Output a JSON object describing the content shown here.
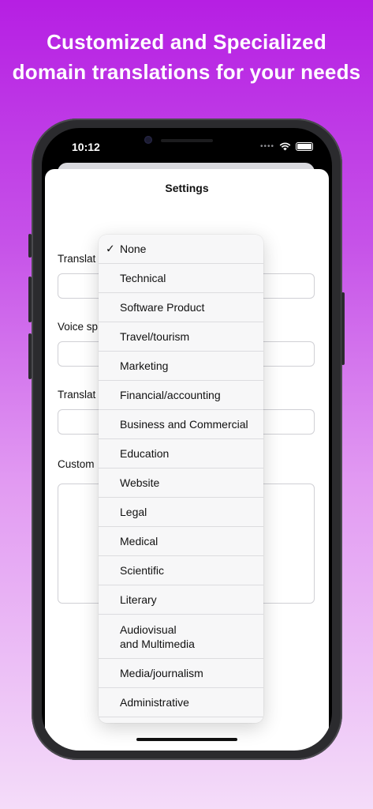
{
  "promo": {
    "headline_line1": "Customized and Specialized",
    "headline_line2": "domain translations for your needs"
  },
  "status_bar": {
    "time": "10:12",
    "icons": [
      "cellular-dots-icon",
      "wifi-icon",
      "battery-icon"
    ]
  },
  "settings": {
    "title": "Settings",
    "rows": [
      {
        "label": "Translat"
      },
      {
        "label": "Voice sp"
      },
      {
        "label": "Translat"
      },
      {
        "label": "Custom"
      }
    ]
  },
  "domain_menu": {
    "selected": "None",
    "items": [
      {
        "label": "None",
        "checked": true
      },
      {
        "label": "Technical"
      },
      {
        "label": "Software Product"
      },
      {
        "label": "Travel/tourism"
      },
      {
        "label": "Marketing"
      },
      {
        "label": "Financial/accounting"
      },
      {
        "label": "Business and Commercial"
      },
      {
        "label": "Education"
      },
      {
        "label": "Website"
      },
      {
        "label": "Legal"
      },
      {
        "label": "Medical"
      },
      {
        "label": "Scientific"
      },
      {
        "label": "Literary"
      },
      {
        "label": "Audiovisual\nand Multimedia",
        "tall": true
      },
      {
        "label": "Media/journalism"
      },
      {
        "label": "Administrative"
      }
    ]
  }
}
